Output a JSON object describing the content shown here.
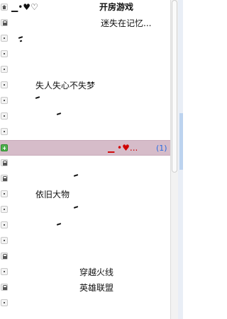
{
  "rows": [
    {
      "icon": "home",
      "texts": [
        {
          "t": "▁•♥♡"
        },
        {
          "t": "开房游戏"
        }
      ]
    },
    {
      "icon": "lock",
      "texts": [
        {
          "t": "迷失在记忆..."
        }
      ]
    },
    {
      "icon": "dot",
      "texts": []
    },
    {
      "icon": "dot",
      "texts": []
    },
    {
      "icon": "dot",
      "texts": []
    },
    {
      "icon": "dot",
      "texts": [
        {
          "t": "失人失心不失梦"
        }
      ]
    },
    {
      "icon": "dot",
      "texts": []
    },
    {
      "icon": "dot",
      "texts": []
    },
    {
      "icon": "dot",
      "texts": []
    },
    {
      "icon": "plus",
      "texts": [
        {
          "t": "▁ •♥..."
        }
      ],
      "count": "(1)"
    },
    {
      "icon": "lock",
      "texts": []
    },
    {
      "icon": "lock",
      "texts": []
    },
    {
      "icon": "dot",
      "texts": [
        {
          "t": "依旧大物"
        }
      ]
    },
    {
      "icon": "dot",
      "texts": []
    },
    {
      "icon": "dot",
      "texts": []
    },
    {
      "icon": "dot",
      "texts": []
    },
    {
      "icon": "lock",
      "texts": []
    },
    {
      "icon": "dot",
      "texts": [
        {
          "t": "穿越火线"
        }
      ]
    },
    {
      "icon": "lock",
      "texts": [
        {
          "t": "英雄联盟"
        }
      ]
    },
    {
      "icon": "dot",
      "texts": []
    }
  ]
}
